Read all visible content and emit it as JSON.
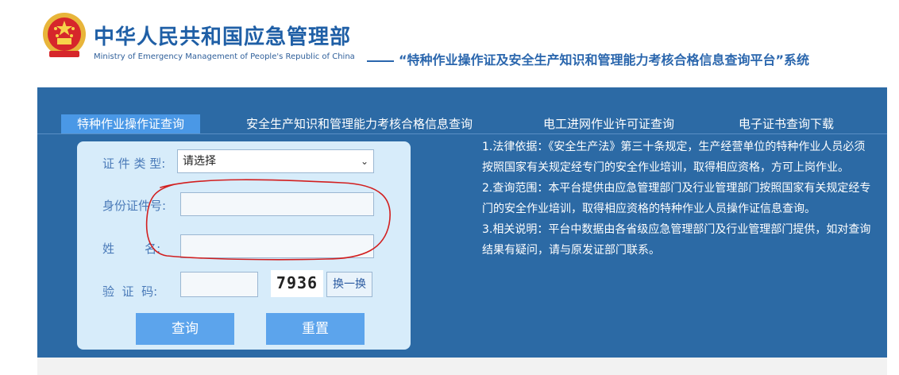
{
  "header": {
    "title_cn": "中华人民共和国应急管理部",
    "title_en": "Ministry of Emergency Management of People's Republic of China",
    "slogan": "“特种作业操作证及安全生产知识和管理能力考核合格信息查询平台”系统"
  },
  "tabs": [
    {
      "label": "特种作业操作证查询",
      "active": true
    },
    {
      "label": "安全生产知识和管理能力考核合格信息查询",
      "active": false
    },
    {
      "label": "电工进网作业许可证查询",
      "active": false
    },
    {
      "label": "电子证书查询下载",
      "active": false
    }
  ],
  "form": {
    "cert_type_label": "证 件 类 型:",
    "cert_type_value": "请选择",
    "id_label": "身份证件号:",
    "id_value": "",
    "name_label": "姓        名:",
    "name_value": "",
    "captcha_label": "验  证  码:",
    "captcha_value": "",
    "captcha_text": "7936",
    "refresh_label": "换一换",
    "query_label": "查询",
    "reset_label": "重置"
  },
  "info": {
    "p1": "1.法律依据：《安全生产法》第三十条规定，生产经营单位的特种作业人员必须按照国家有关规定经专门的安全作业培训，取得相应资格，方可上岗作业。",
    "p2": "2.查询范围：本平台提供由应急管理部门及行业管理部门按照国家有关规定经专门的安全作业培训，取得相应资格的特种作业人员操作证信息查询。",
    "p3": "3.相关说明：平台中数据由各省级应急管理部门及行业管理部门提供，如对查询结果有疑问，请与原发证部门联系。"
  },
  "colors": {
    "band": "#2c6aa5",
    "active_tab": "#4a98e6",
    "panel": "#d7ecfa",
    "button": "#5ca4ec",
    "title": "#1f5fa6",
    "annotation": "#d21f1f"
  },
  "icons": {
    "emblem": "national-emblem-icon",
    "dropdown": "chevron-down-icon"
  }
}
